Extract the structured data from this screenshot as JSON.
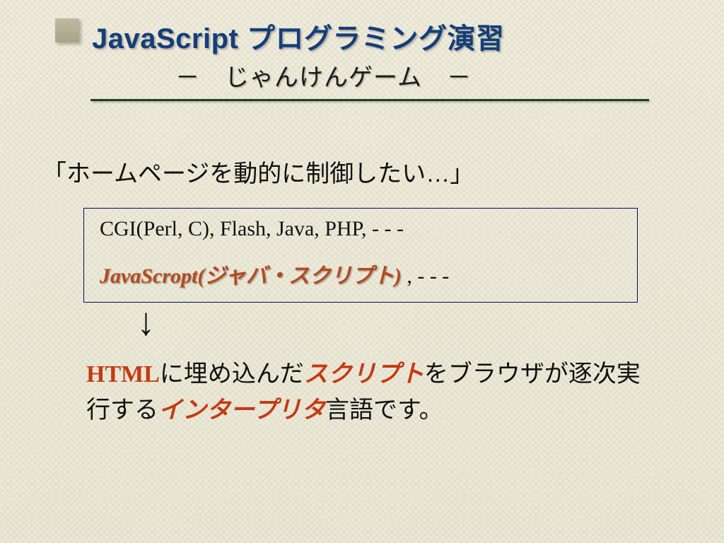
{
  "title": "JavaScript プログラミング演習",
  "subtitle": "－　じゃんけんゲーム　－",
  "body": {
    "intro": "「ホームページを動的に制御したい…」",
    "box": {
      "line1": "CGI(Perl, C), Flash, Java, PHP, - - -",
      "js_en": "JavaScropt(",
      "js_jp": "ジャバ・スクリプト",
      "js_close": ")",
      "tail": " , - - -"
    },
    "arrow": "↓",
    "explain": {
      "kw_html": "HTML",
      "seg1": "に埋め込んだ",
      "kw_script": "スクリプト",
      "seg2": "をブラウザが逐次実行する",
      "kw_interp": "インタープリタ",
      "seg3": "言語です。"
    }
  }
}
